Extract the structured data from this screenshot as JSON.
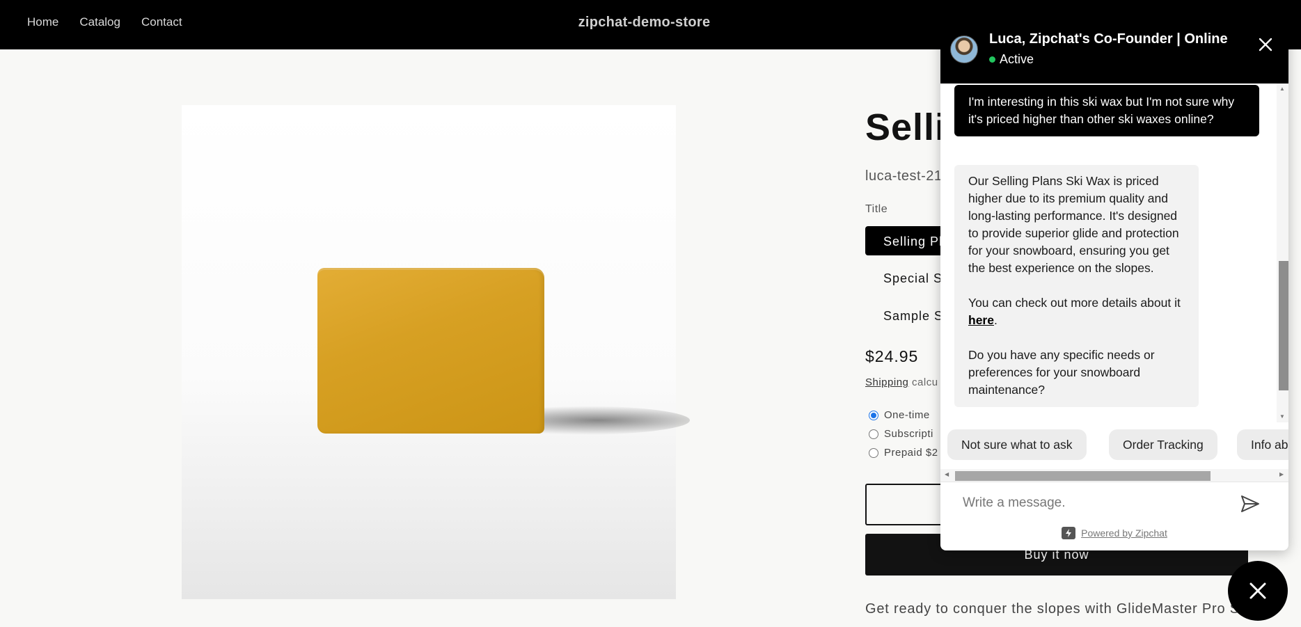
{
  "header": {
    "nav": [
      "Home",
      "Catalog",
      "Contact"
    ],
    "store_name": "zipchat-demo-store"
  },
  "product": {
    "title": "Selli",
    "sku": "luca-test-21",
    "option_label": "Title",
    "variants": [
      "Selling Pl",
      "Special S",
      "Sample S"
    ],
    "price": "$24.95",
    "shipping_link": "Shipping",
    "shipping_rest": " calcu",
    "purchase_options": [
      "One-time",
      "Subscripti",
      "Prepaid $2"
    ],
    "buy_now": "Buy it now",
    "description": "Get ready to conquer the slopes with GlideMaster Pro S"
  },
  "chat": {
    "agent_name": "Luca, Zipchat's Co-Founder | Online",
    "status": "Active",
    "user_message": "I'm interesting in this ski wax but I'm not sure why it's priced higher than other ski waxes online?",
    "bot_p1": "Our Selling Plans Ski Wax is priced higher due to its premium quality and long-lasting performance. It's designed to provide superior glide and protection for your snowboard, ensuring you get the best experience on the slopes.",
    "bot_p2_prefix": "You can check out more details about it ",
    "bot_p2_link": "here",
    "bot_p2_suffix": ".",
    "bot_p3": "Do you have any specific needs or preferences for your snowboard maintenance?",
    "suggestions": [
      "Not sure what to ask",
      "Order Tracking",
      "Info ab"
    ],
    "input_placeholder": "Write a message.",
    "powered_by": "Powered by Zipchat"
  }
}
